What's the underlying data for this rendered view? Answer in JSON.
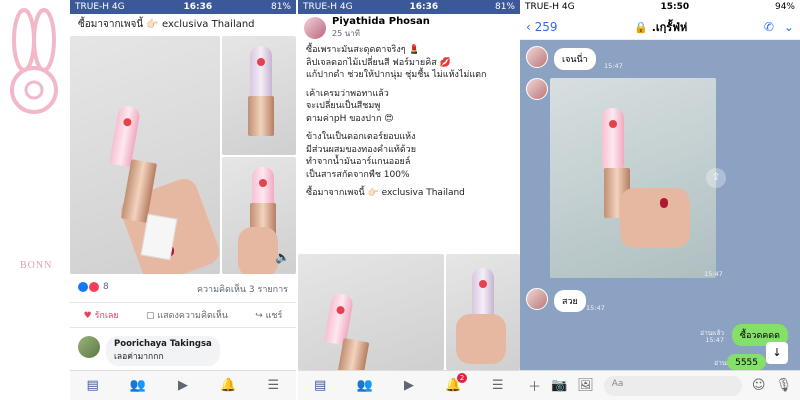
{
  "left_panel": {
    "status": {
      "carrier": "TRUE-H",
      "network": "4G",
      "time": "16:36",
      "battery": "81%"
    },
    "page_name": "ซื้อมาจากเพจนี้ 👉🏻 exclusiva Thailand",
    "reactions_count": "8",
    "comments_count": "ความคิดเห็น 3 รายการ",
    "actions": {
      "like": "รักเลย",
      "comment": "แสดงความคิดเห็น",
      "share": "แชร์"
    },
    "comment": {
      "author": "Poorichaya Takingsa",
      "text": "เลอค่ามากกก"
    }
  },
  "middle_panel": {
    "status": {
      "carrier": "TRUE-H",
      "network": "4G",
      "time": "16:36",
      "battery": "81%"
    },
    "author": "Piyathida Phosan",
    "time": "25 นาที",
    "lines": [
      "ซื้อเพราะมันสะดุดตาจริงๆ 💄",
      "ลิปเจลดอกไม้เปลี่ยนสี ฟอร์มายคิส 💋",
      "แก้ปากดำ ช่วยให้ปากนุ่ม ชุ่มชื้น ไม่แห้งไม่แตก",
      "",
      "เค้าเครมว่าพอทาแล้ว",
      "จะเปลี่ยนเป็นสีชมพู",
      "ตามค่าpH ของปาก 😍",
      "",
      "ข้างในเป็นดอกเตอร์ยอบแห้ง",
      "มีส่วนผสมของทองคำแท้ด้วย",
      "ทำจากน้ำมันอาร์แกนออยล์",
      "เป็นสารสกัดจากพืช 100%",
      "",
      "ซื้อมาจากเพจนี้ 👉🏻 exclusiva Thailand"
    ],
    "notif_badge": "2"
  },
  "right_panel": {
    "status": {
      "carrier": "TRUE-H",
      "network": "4G",
      "time": "15:50",
      "battery": "94%"
    },
    "back_count": "259",
    "chat_title": ".เกฺรั้ฟ่ห่",
    "messages": [
      {
        "text": "เจนนี่า",
        "time": "15:47"
      },
      {
        "text": "",
        "time": "15:47"
      },
      {
        "text": "สวย",
        "time": "15:47"
      },
      {
        "text": "ซื้อวดคดด",
        "time": "15:47",
        "read": "อ่านแล้ว"
      },
      {
        "text": "5555",
        "time": "15:47",
        "read": "อ่านแล้ว"
      }
    ],
    "input_placeholder": "Aa"
  },
  "watermark": "BONN"
}
